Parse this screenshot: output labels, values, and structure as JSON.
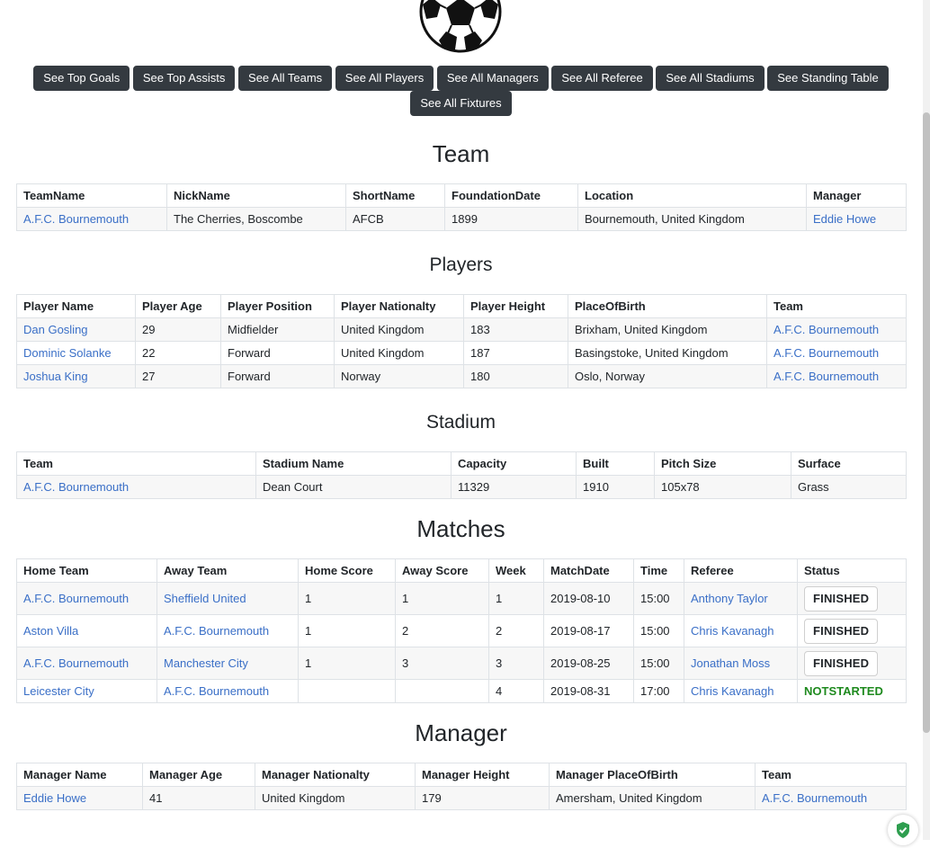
{
  "nav": {
    "buttons": [
      "See Top Goals",
      "See Top Assists",
      "See All Teams",
      "See All Players",
      "See All Managers",
      "See All Referee",
      "See All Stadiums",
      "See Standing Table",
      "See All Fixtures"
    ]
  },
  "team": {
    "title": "Team",
    "headers": [
      "TeamName",
      "NickName",
      "ShortName",
      "FoundationDate",
      "Location",
      "Manager"
    ],
    "row": {
      "name": "A.F.C. Bournemouth",
      "nick": "The Cherries, Boscombe",
      "short": "AFCB",
      "founded": "1899",
      "location": "Bournemouth, United Kingdom",
      "manager": "Eddie Howe"
    }
  },
  "players": {
    "title": "Players",
    "headers": [
      "Player Name",
      "Player Age",
      "Player Position",
      "Player Nationalty",
      "Player Height",
      "PlaceOfBirth",
      "Team"
    ],
    "rows": [
      {
        "name": "Dan Gosling",
        "age": "29",
        "position": "Midfielder",
        "nationality": "United Kingdom",
        "height": "183",
        "birth": "Brixham, United Kingdom",
        "team": "A.F.C. Bournemouth"
      },
      {
        "name": "Dominic Solanke",
        "age": "22",
        "position": "Forward",
        "nationality": "United Kingdom",
        "height": "187",
        "birth": "Basingstoke, United Kingdom",
        "team": "A.F.C. Bournemouth"
      },
      {
        "name": "Joshua King",
        "age": "27",
        "position": "Forward",
        "nationality": "Norway",
        "height": "180",
        "birth": "Oslo, Norway",
        "team": "A.F.C. Bournemouth"
      }
    ]
  },
  "stadium": {
    "title": "Stadium",
    "headers": [
      "Team",
      "Stadium Name",
      "Capacity",
      "Built",
      "Pitch Size",
      "Surface"
    ],
    "row": {
      "team": "A.F.C. Bournemouth",
      "name": "Dean Court",
      "capacity": "11329",
      "built": "1910",
      "pitch": "105x78",
      "surface": "Grass"
    }
  },
  "matches": {
    "title": "Matches",
    "headers": [
      "Home Team",
      "Away Team",
      "Home Score",
      "Away Score",
      "Week",
      "MatchDate",
      "Time",
      "Referee",
      "Status"
    ],
    "rows": [
      {
        "home": "A.F.C. Bournemouth",
        "away": "Sheffield United",
        "hs": "1",
        "as": "1",
        "week": "1",
        "date": "2019-08-10",
        "time": "15:00",
        "referee": "Anthony Taylor",
        "status": "FINISHED"
      },
      {
        "home": "Aston Villa",
        "away": "A.F.C. Bournemouth",
        "hs": "1",
        "as": "2",
        "week": "2",
        "date": "2019-08-17",
        "time": "15:00",
        "referee": "Chris Kavanagh",
        "status": "FINISHED"
      },
      {
        "home": "A.F.C. Bournemouth",
        "away": "Manchester City",
        "hs": "1",
        "as": "3",
        "week": "3",
        "date": "2019-08-25",
        "time": "15:00",
        "referee": "Jonathan Moss",
        "status": "FINISHED"
      },
      {
        "home": "Leicester City",
        "away": "A.F.C. Bournemouth",
        "hs": "",
        "as": "",
        "week": "4",
        "date": "2019-08-31",
        "time": "17:00",
        "referee": "Chris Kavanagh",
        "status": "NOTSTARTED"
      }
    ]
  },
  "manager": {
    "title": "Manager",
    "headers": [
      "Manager Name",
      "Manager Age",
      "Manager Nationalty",
      "Manager Height",
      "Manager PlaceOfBirth",
      "Team"
    ],
    "row": {
      "name": "Eddie Howe",
      "age": "41",
      "nationality": "United Kingdom",
      "height": "179",
      "birth": "Amersham, United Kingdom",
      "team": "A.F.C. Bournemouth"
    }
  },
  "colors": {
    "link": "#3a6fc7",
    "nav_button_bg": "#343a40",
    "status_notstarted": "#1e8a1e",
    "shield": "#2e9e4f"
  }
}
